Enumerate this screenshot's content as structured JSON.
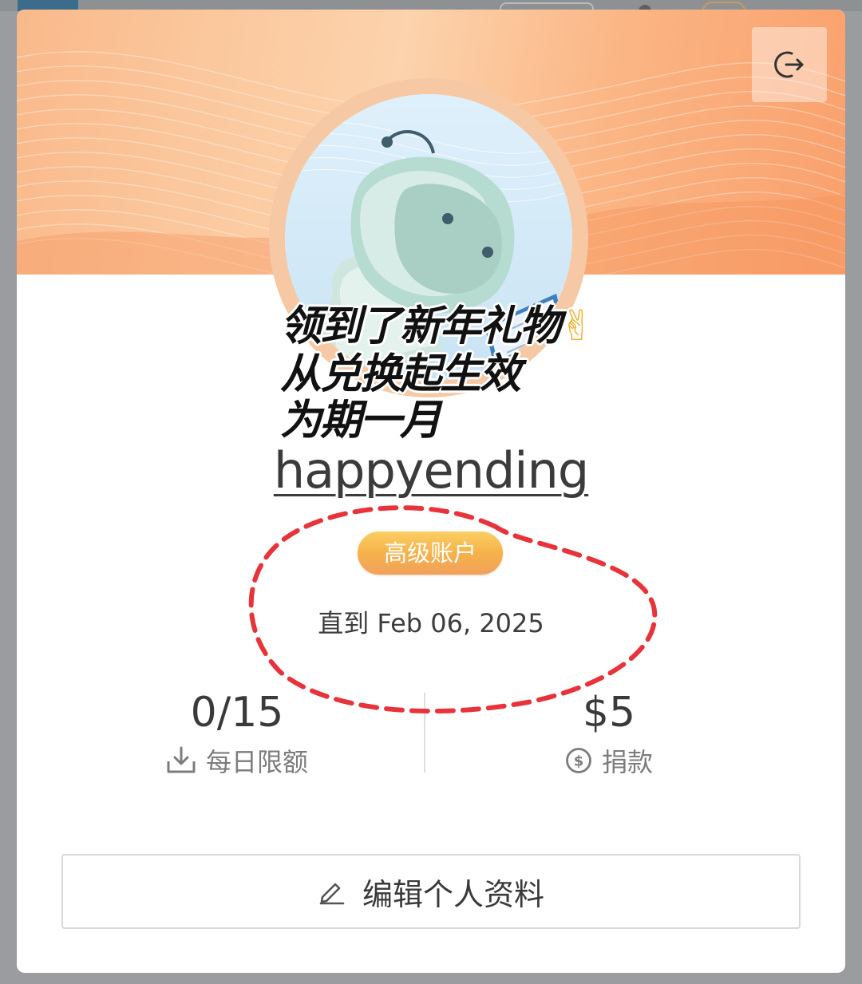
{
  "overlay_caption": {
    "line1": "领到了新年礼物",
    "line1_emoji": "✌",
    "line2": "从兑换起生效",
    "line3": "为期一月"
  },
  "profile": {
    "username": "happyending",
    "badge_label": "高级账户",
    "until_prefix": "直到",
    "until_date": "Feb 06, 2025"
  },
  "stats": {
    "daily_limit_value": "0/15",
    "daily_limit_label": "每日限额",
    "donation_value": "$5",
    "donation_label": "捐款"
  },
  "actions": {
    "edit_profile_label": "编辑个人资料"
  },
  "icons": {
    "logout": "logout-icon",
    "download": "download-icon",
    "dollar": "dollar-circle-icon",
    "edit": "pencil-icon"
  },
  "colors": {
    "banner_orange": "#f9a06c",
    "badge_gold": "#f6b24a",
    "annotation_red": "#e8333a"
  }
}
